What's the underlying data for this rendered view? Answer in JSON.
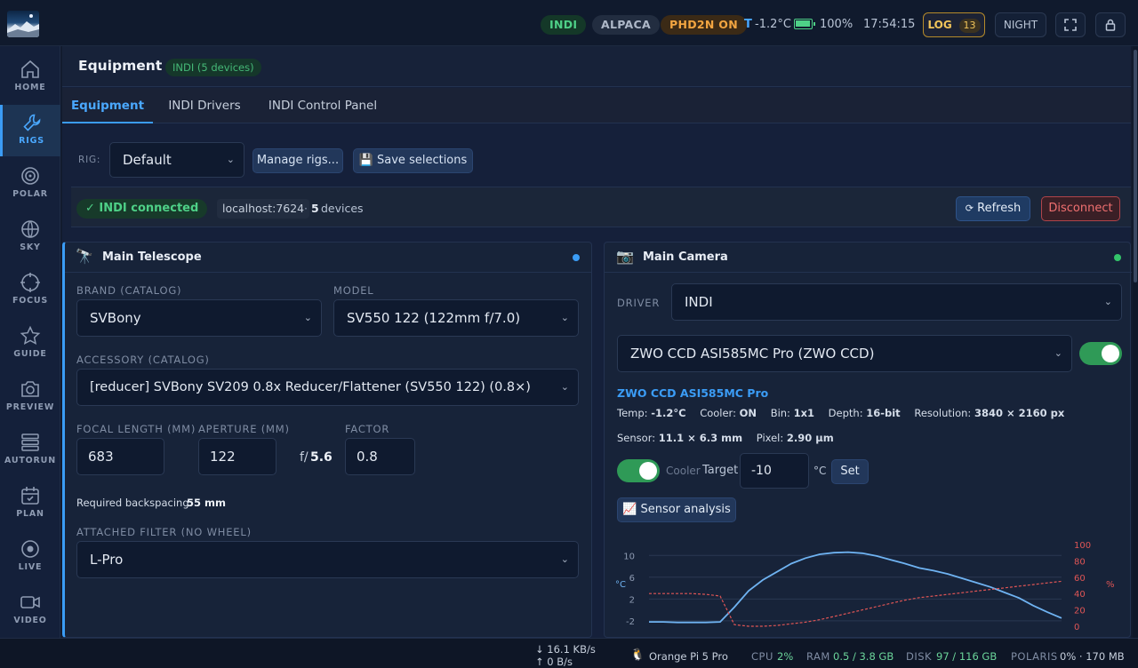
{
  "topbar": {
    "indi": "INDI",
    "alpaca": "ALPACA",
    "phd2": "PHD2N ON",
    "temp_label": "T",
    "temp_value": "-1.2°C",
    "battery": "100%",
    "time": "17:54:15",
    "log_label": "LOG",
    "log_count": "13",
    "night": "NIGHT"
  },
  "sidebar": {
    "items": [
      {
        "label": "HOME",
        "icon": "home-icon"
      },
      {
        "label": "RIGS",
        "icon": "wrench-icon"
      },
      {
        "label": "POLAR",
        "icon": "polar-icon"
      },
      {
        "label": "SKY",
        "icon": "globe-icon"
      },
      {
        "label": "FOCUS",
        "icon": "focus-icon"
      },
      {
        "label": "GUIDE",
        "icon": "star-icon"
      },
      {
        "label": "PREVIEW",
        "icon": "camera-icon"
      },
      {
        "label": "AUTORUN",
        "icon": "stack-icon"
      },
      {
        "label": "PLAN",
        "icon": "calendar-icon"
      },
      {
        "label": "LIVE",
        "icon": "live-icon"
      },
      {
        "label": "VIDEO",
        "icon": "video-icon"
      }
    ]
  },
  "header": {
    "title": "Equipment",
    "badge": "INDI (5 devices)"
  },
  "tabs": [
    "Equipment",
    "INDI Drivers",
    "INDI Control Panel"
  ],
  "rig": {
    "label": "RIG:",
    "selected": "Default",
    "manage": "Manage rigs...",
    "save": "💾 Save selections"
  },
  "connection": {
    "status": "✓ INDI connected",
    "host": "localhost:7624",
    "sep": "·",
    "devices_count": "5",
    "devices_label": "devices",
    "refresh": "Refresh",
    "disconnect": "Disconnect"
  },
  "telescope": {
    "title": "Main Telescope",
    "brand_label": "BRAND (CATALOG)",
    "brand": "SVBony",
    "model_label": "MODEL",
    "model": "SV550 122 (122mm f/7.0)",
    "accessory_label": "ACCESSORY (CATALOG)",
    "accessory": "[reducer] SVBony SV209 0.8x Reducer/Flattener (SV550 122) (0.8×)",
    "focal_label": "FOCAL LENGTH (MM)",
    "focal": "683",
    "aperture_label": "APERTURE (MM)",
    "aperture": "122",
    "fratio_prefix": "f/",
    "fratio": "5.6",
    "factor_label": "FACTOR",
    "factor": "0.8",
    "backspacing_label": "Required backspacing:",
    "backspacing": "55 mm",
    "filter_label": "ATTACHED FILTER (NO WHEEL)",
    "filter": "L-Pro"
  },
  "camera": {
    "title": "Main Camera",
    "driver_label": "DRIVER",
    "driver": "INDI",
    "device": "ZWO CCD ASI585MC Pro (ZWO CCD)",
    "name": "ZWO CCD ASI585MC Pro",
    "temp_label": "Temp:",
    "temp": "-1.2°C",
    "cooler_label": "Cooler:",
    "cooler": "ON",
    "bin_label": "Bin:",
    "bin": "1x1",
    "depth_label": "Depth:",
    "depth": "16-bit",
    "res_label": "Resolution:",
    "res": "3840 × 2160 px",
    "sensor_label": "Sensor:",
    "sensor": "11.1 × 6.3 mm",
    "pixel_label": "Pixel:",
    "pixel": "2.90 µm",
    "cooler_toggle": "Cooler",
    "target_label": "Target",
    "target": "-10",
    "unit": "°C",
    "set": "Set",
    "analysis": "📈 Sensor analysis"
  },
  "chart_data": {
    "type": "line",
    "title": "",
    "ylabel": "°C",
    "y2label": "%",
    "ylim": [
      -3,
      12
    ],
    "y2lim": [
      0,
      100
    ],
    "yticks": [
      "10",
      "6",
      "2",
      "-2"
    ],
    "y2ticks": [
      "100",
      "80",
      "60",
      "40",
      "20",
      "0"
    ],
    "grid": true,
    "series": [
      {
        "color": "#6fb3f2",
        "axis": "left",
        "values": [
          -2.2,
          -2.2,
          -2.3,
          -2.3,
          -2.3,
          -2.2,
          0.5,
          3.5,
          5.5,
          7.0,
          8.5,
          9.5,
          10.2,
          10.5,
          10.6,
          10.4,
          9.9,
          9.2,
          8.5,
          7.7,
          7.2,
          6.6,
          5.8,
          5.0,
          4.2,
          3.2,
          2.2,
          0.8,
          -0.4,
          -1.5
        ]
      },
      {
        "color": "#e05555",
        "axis": "right",
        "dash": true,
        "values": [
          40,
          40,
          40,
          40,
          39,
          37,
          2,
          0,
          0,
          1,
          3,
          5,
          8,
          12,
          16,
          20,
          24,
          28,
          32,
          35,
          37,
          39,
          41,
          43,
          45,
          47,
          49,
          51,
          53,
          55
        ]
      }
    ]
  },
  "statusbar": {
    "down": "↓ 16.1 KB/s",
    "up": "↑ 0 B/s",
    "host": "Orange Pi 5 Pro",
    "cpu_label": "CPU",
    "cpu": "2%",
    "ram_label": "RAM",
    "ram": "0.5 / 3.8 GB",
    "disk_label": "DISK",
    "disk": "97 / 116 GB",
    "polaris_label": "POLARIS",
    "polaris": "0% · 170 MB"
  },
  "colors": {
    "accent": "#3b9cf5",
    "green": "#33c46a",
    "danger": "#e05555",
    "phd2": "#f2a541"
  }
}
